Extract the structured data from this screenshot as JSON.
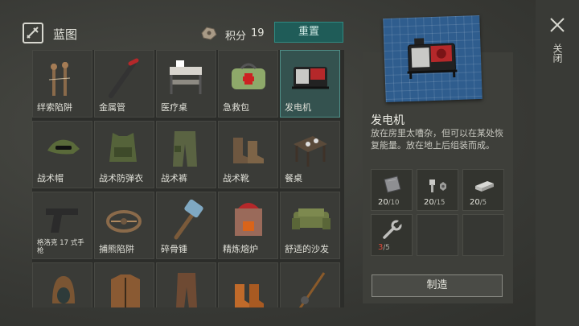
{
  "header": {
    "title": "蓝图",
    "score_label": "积分",
    "score_value": "19",
    "reset_label": "重置"
  },
  "grid": {
    "items": [
      {
        "label": "绊索陷阱",
        "icon": "tripwire-trap-icon"
      },
      {
        "label": "金属管",
        "icon": "metal-pipe-icon"
      },
      {
        "label": "医疗桌",
        "icon": "medical-table-icon"
      },
      {
        "label": "急救包",
        "icon": "first-aid-kit-icon"
      },
      {
        "label": "发电机",
        "icon": "generator-icon",
        "selected": true
      },
      {
        "label": "战术帽",
        "icon": "tactical-cap-icon"
      },
      {
        "label": "战术防弹衣",
        "icon": "tactical-vest-icon"
      },
      {
        "label": "战术裤",
        "icon": "tactical-pants-icon"
      },
      {
        "label": "战术靴",
        "icon": "tactical-boots-icon"
      },
      {
        "label": "餐桌",
        "icon": "dining-table-icon"
      },
      {
        "label": "格洛克 17 式手枪",
        "icon": "glock-pistol-icon"
      },
      {
        "label": "捕熊陷阱",
        "icon": "bear-trap-icon"
      },
      {
        "label": "碎骨锤",
        "icon": "bone-hammer-icon"
      },
      {
        "label": "精炼熔炉",
        "icon": "furnace-icon"
      },
      {
        "label": "舒适的沙发",
        "icon": "sofa-icon"
      },
      {
        "label": "",
        "icon": "hood-icon"
      },
      {
        "label": "",
        "icon": "jacket-icon"
      },
      {
        "label": "",
        "icon": "pants-icon"
      },
      {
        "label": "",
        "icon": "boots-icon"
      },
      {
        "label": "",
        "icon": "fishing-rod-icon"
      }
    ]
  },
  "detail": {
    "name": "发电机",
    "description": "放在房里太嘈杂，但可以在某处恢复能量。放在地上后组装而成。",
    "materials": [
      {
        "have": "20",
        "need": "/10",
        "icon": "metal-sheet-icon",
        "lacking": false
      },
      {
        "have": "20",
        "need": "/15",
        "icon": "bolt-nut-icon",
        "lacking": false
      },
      {
        "have": "20",
        "need": "/5",
        "icon": "metal-bar-icon",
        "lacking": false
      },
      {
        "have": "3",
        "need": "/5",
        "icon": "wrench-icon",
        "lacking": true
      }
    ],
    "craft_label": "制造"
  },
  "close_label": "关闭",
  "colors": {
    "accent": "#1f5c58",
    "selected_cell": "#34524f",
    "lacking": "#e04a3a",
    "blueprint": "#2f5d8e"
  }
}
